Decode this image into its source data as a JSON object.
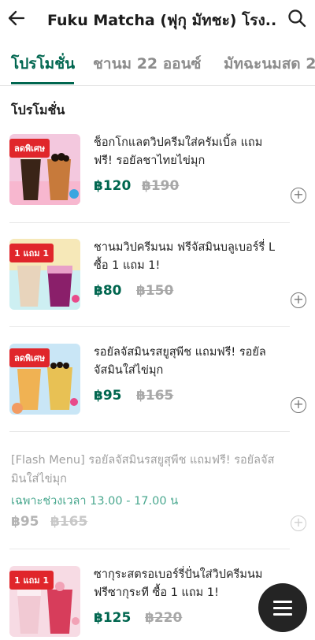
{
  "header": {
    "title": "Fuku Matcha (ฟุกุ มัทชะ) โรง..."
  },
  "tabs": [
    {
      "label": "โปรโมชั่น",
      "active": true
    },
    {
      "label": "ชานม 22 ออนซ์",
      "active": false
    },
    {
      "label": "มัทฉะนมสด 2",
      "active": false
    }
  ],
  "section": {
    "title": "โปรโมชั่น"
  },
  "items": [
    {
      "badge": "ลดพิเศษ",
      "name": "ช็อกโกแลตวิปครีมใส่ครัมเบิ้ล แถมฟรี! รอยัลชาไทยไข่มุก",
      "price": "฿120",
      "old_price": "฿190"
    },
    {
      "badge": "1 แถม 1",
      "name": "ชานมวิปครีมนม ฟรีจัสมินบลูเบอร์รี่ L ซื้อ 1 แถม 1!",
      "price": "฿80",
      "old_price": "฿150"
    },
    {
      "badge": "ลดพิเศษ",
      "name": "รอยัลจัสมินรสยูสุพีช แถมฟรี! รอยัลจัสมินใส่ไข่มุก",
      "price": "฿95",
      "old_price": "฿165"
    },
    {
      "badge": "1 แถม 1",
      "name": "ซากุระสตรอเบอร์รี่ปั่นใส่วิปครีมนม ฟรีซากุระที ซื้อ 1 แถม 1!",
      "price": "฿125",
      "old_price": "฿220"
    }
  ],
  "flash_item": {
    "name": "[Flash Menu] รอยัลจัสมินรสยูสุพีช แถมฟรี! รอยัลจัสมินใส่ไข่มุก",
    "time": "เฉพาะช่วงเวลา 13.00 - 17.00 น",
    "price": "฿95",
    "old_price": "฿165"
  },
  "icons": {
    "back": "arrow-left-icon",
    "search": "search-icon",
    "add": "plus-circle-icon",
    "menu": "hamburger-menu-icon"
  },
  "colors": {
    "accent": "#00664f",
    "badge": "#e0262b",
    "strike": "#a8a8a8",
    "fab": "#242424"
  }
}
